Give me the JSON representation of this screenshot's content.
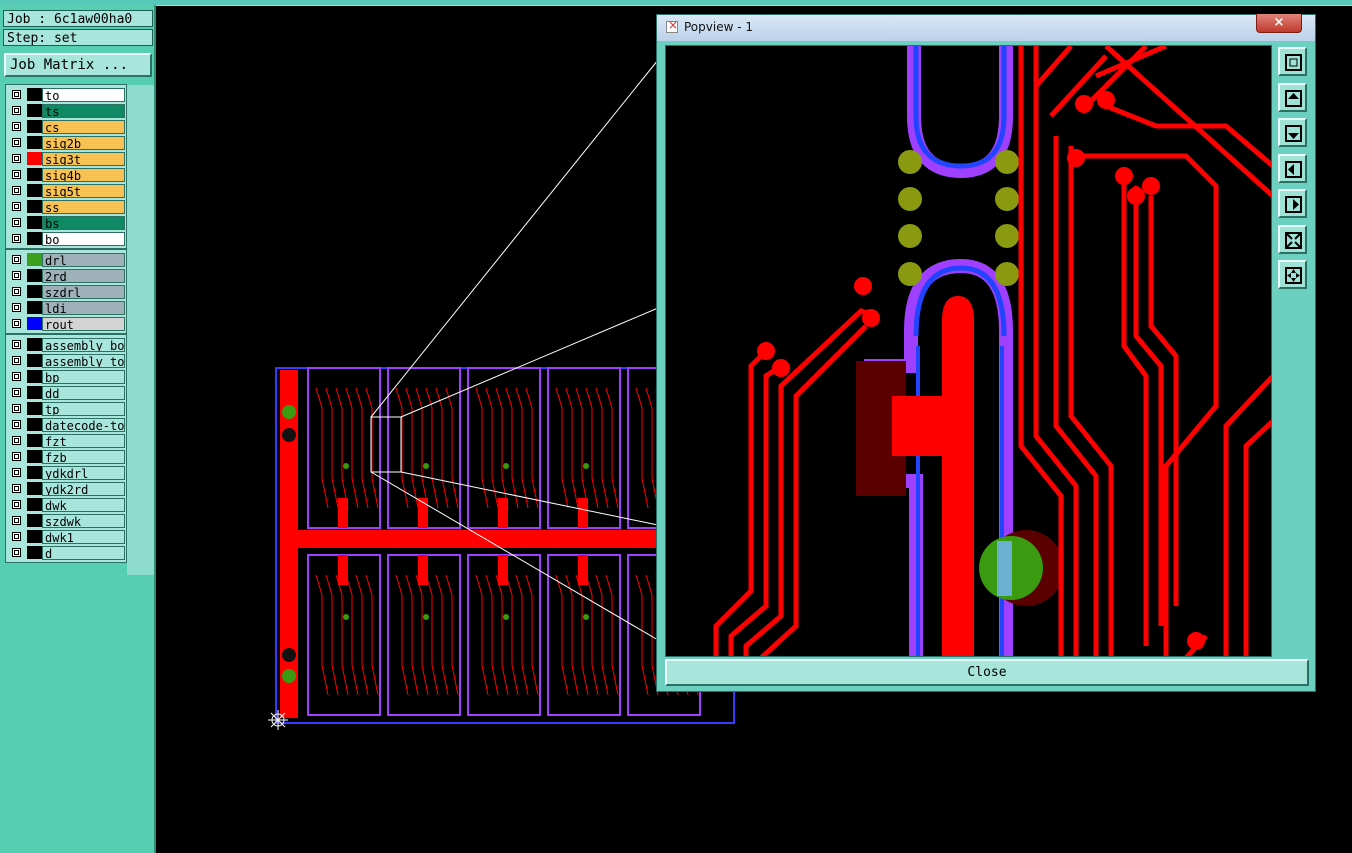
{
  "job": {
    "label": "Job : 6c1aw00ha0"
  },
  "step": {
    "label": "Step: set"
  },
  "matrix_button": "Job Matrix ...",
  "layers_board": [
    {
      "name": "to",
      "color": "#ffffff",
      "swatch": "#000000"
    },
    {
      "name": "ts",
      "color": "#0f8a64",
      "swatch": "#000000"
    },
    {
      "name": "cs",
      "color": "#f7c252",
      "swatch": "#000000"
    },
    {
      "name": "sig2b",
      "color": "#f7c252",
      "swatch": "#000000"
    },
    {
      "name": "sig3t",
      "color": "#f7c252",
      "swatch": "#ff0000"
    },
    {
      "name": "sig4b",
      "color": "#f7c252",
      "swatch": "#000000"
    },
    {
      "name": "sig5t",
      "color": "#f7c252",
      "swatch": "#000000"
    },
    {
      "name": "ss",
      "color": "#f7c252",
      "swatch": "#000000"
    },
    {
      "name": "bs",
      "color": "#0f8a64",
      "swatch": "#000000"
    },
    {
      "name": "bo",
      "color": "#ffffff",
      "swatch": "#000000"
    }
  ],
  "layers_drill": [
    {
      "name": "drl",
      "color": "#9fb1b8",
      "swatch": "#3b9e1d"
    },
    {
      "name": "2rd",
      "color": "#9fb1b8",
      "swatch": "#000000"
    },
    {
      "name": "szdrl",
      "color": "#9fb1b8",
      "swatch": "#000000"
    },
    {
      "name": "ldi",
      "color": "#9fb1b8",
      "swatch": "#000000"
    },
    {
      "name": "rout",
      "color": "#d4d4d4",
      "swatch": "#0000ff"
    }
  ],
  "layers_misc": [
    {
      "name": "assembly_bot",
      "color": "#a8e6dc",
      "swatch": "#000000"
    },
    {
      "name": "assembly_top",
      "color": "#a8e6dc",
      "swatch": "#000000"
    },
    {
      "name": "bp",
      "color": "#a8e6dc",
      "swatch": "#000000"
    },
    {
      "name": "dd",
      "color": "#a8e6dc",
      "swatch": "#000000"
    },
    {
      "name": "tp",
      "color": "#a8e6dc",
      "swatch": "#000000"
    },
    {
      "name": "datecode-top",
      "color": "#a8e6dc",
      "swatch": "#000000"
    },
    {
      "name": "fzt",
      "color": "#a8e6dc",
      "swatch": "#000000"
    },
    {
      "name": "fzb",
      "color": "#a8e6dc",
      "swatch": "#000000"
    },
    {
      "name": "ydkdrl",
      "color": "#a8e6dc",
      "swatch": "#000000"
    },
    {
      "name": "ydk2rd",
      "color": "#a8e6dc",
      "swatch": "#000000"
    },
    {
      "name": "dwk",
      "color": "#a8e6dc",
      "swatch": "#000000"
    },
    {
      "name": "szdwk",
      "color": "#a8e6dc",
      "swatch": "#000000"
    },
    {
      "name": "dwk1",
      "color": "#a8e6dc",
      "swatch": "#000000"
    },
    {
      "name": "d",
      "color": "#a8e6dc",
      "swatch": "#000000"
    }
  ],
  "popup": {
    "title": "Popview - 1",
    "close_x": "×",
    "close_label": "Close"
  },
  "toolbar_icons": [
    "zoom-fit-icon",
    "pan-up-icon",
    "pan-down-icon",
    "pan-left-icon",
    "pan-right-icon",
    "zoom-out-icon",
    "zoom-in-icon"
  ],
  "colors": {
    "copper": "#ff0000",
    "rout": "#3a3aff",
    "drill": "#4a9a10",
    "outline": "#a040ff",
    "panel": "#55cfb0"
  }
}
